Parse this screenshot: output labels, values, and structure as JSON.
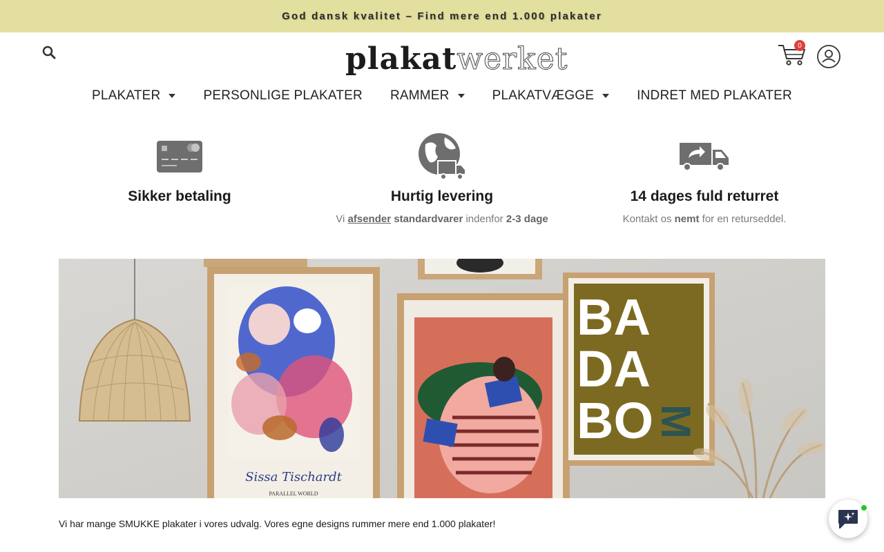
{
  "announcement": "God dansk kvalitet – Find mere end 1.000 plakater",
  "logo": {
    "part1": "plakat",
    "part2": "werket"
  },
  "cart": {
    "count": "0"
  },
  "nav": [
    {
      "label": "PLAKATER",
      "has_dropdown": true
    },
    {
      "label": "PERSONLIGE PLAKATER",
      "has_dropdown": false
    },
    {
      "label": "RAMMER",
      "has_dropdown": true
    },
    {
      "label": "PLAKATVÆGGE",
      "has_dropdown": true
    },
    {
      "label": "INDRET MED PLAKATER",
      "has_dropdown": false
    }
  ],
  "usps": {
    "payment": {
      "title": "Sikker betaling",
      "icon": "credit-card-icon"
    },
    "delivery": {
      "title": "Hurtig levering",
      "icon": "globe-truck-icon",
      "text_1": "Vi",
      "link": "afsender",
      "text_2": "standardvarer",
      "text_3": "indenfor",
      "text_4": "2-3 dage"
    },
    "returns": {
      "title": "14 dages fuld returret",
      "icon": "return-truck-icon",
      "text_1": "Kontakt os",
      "text_2": "nemt",
      "text_3": "for en returseddel."
    }
  },
  "hero": {
    "poster_signature": "Sissa Tischardt",
    "poster_subtitle": "PARALLEL WORLD",
    "poster_letters": [
      "BA",
      "DA",
      "BO",
      "M"
    ]
  },
  "tagline": "Vi har mange SMUKKE plakater i vores udvalg. Vores egne designs rummer mere end 1.000 plakater!",
  "colors": {
    "announcement_bg": "#e3df9f",
    "badge": "#e0403a",
    "online": "#22c52a"
  }
}
